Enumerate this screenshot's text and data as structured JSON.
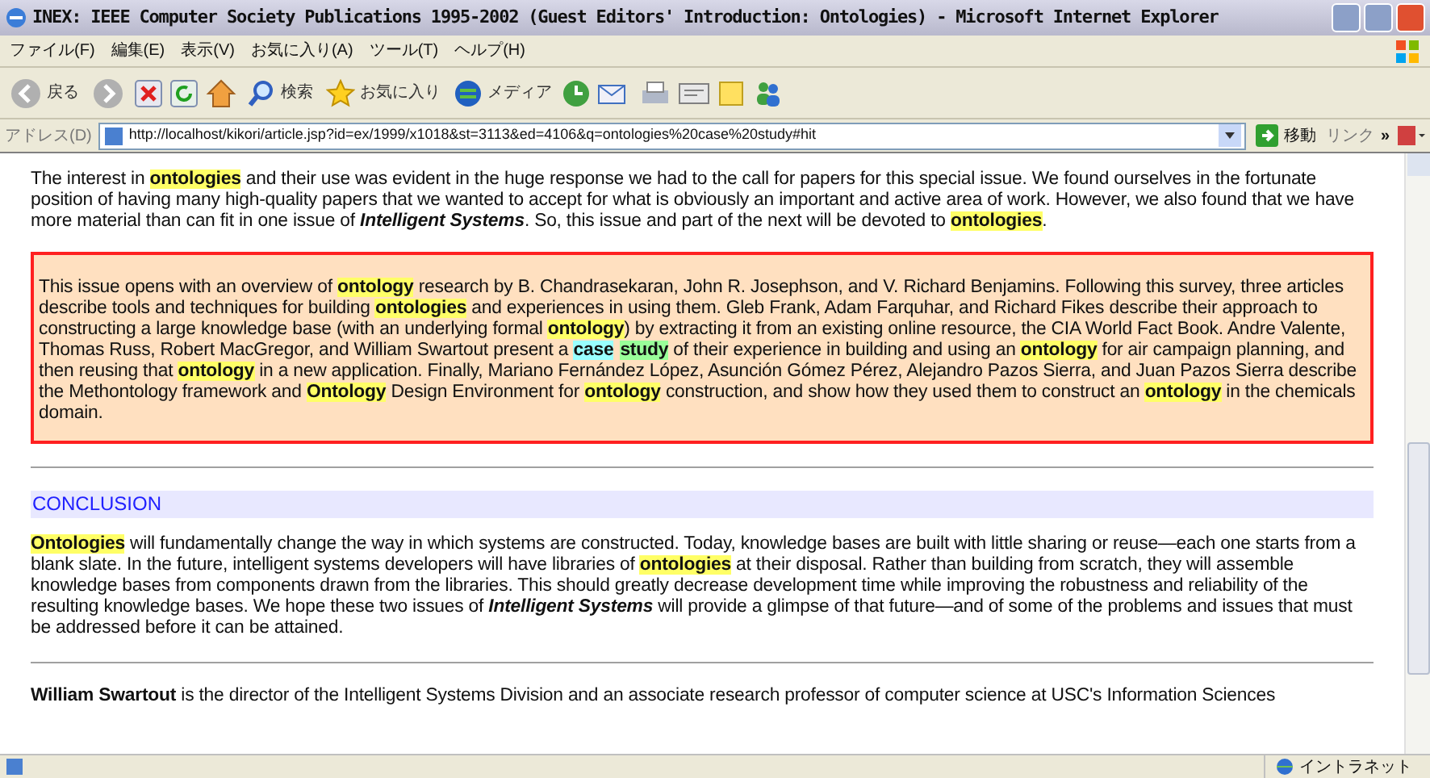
{
  "window": {
    "title": "INEX: IEEE Computer Society Publications 1995-2002 (Guest Editors' Introduction: Ontologies) - Microsoft Internet Explorer"
  },
  "menu": [
    "ファイル(F)",
    "編集(E)",
    "表示(V)",
    "お気に入り(A)",
    "ツール(T)",
    "ヘルプ(H)"
  ],
  "toolbar": {
    "back": "戻る",
    "search": "検索",
    "favorites": "お気に入り",
    "media": "メディア"
  },
  "address_bar": {
    "label": "アドレス(D)",
    "value": "http://localhost/kikori/article.jsp?id=ex/1999/x1018&st=3113&ed=4106&q=ontologies%20case%20study#hit",
    "go": "移動",
    "links": "リンク",
    "more": "»"
  },
  "content": [
    {
      "kind": "paragraph",
      "segments": [
        {
          "kind": "plain",
          "text": "The interest in "
        },
        {
          "kind": "hit",
          "color": "#ffff66",
          "text": "ontologies"
        },
        {
          "kind": "plain",
          "text": " and their use was evident in the huge response we had to the call for papers for this special issue. We found ourselves in the fortunate position of having many high-quality papers that we wanted to accept for what is obviously an important and active area of work. However, we also found that we have more material than can fit in one issue of "
        },
        {
          "kind": "italic",
          "text": "Intelligent Systems"
        },
        {
          "kind": "plain",
          "text": ". So, this issue and part of the next will be devoted to "
        },
        {
          "kind": "hit",
          "color": "#ffff66",
          "text": "ontologies"
        },
        {
          "kind": "plain",
          "text": "."
        }
      ]
    },
    {
      "kind": "hit_box",
      "segments": [
        {
          "kind": "plain",
          "text": "This issue opens with an overview of "
        },
        {
          "kind": "hit",
          "color": "#ffff66",
          "text": "ontology"
        },
        {
          "kind": "plain",
          "text": " research by B. Chandrasekaran, John R. Josephson, and V. Richard Benjamins. Following this survey, three articles describe tools and techniques for building "
        },
        {
          "kind": "hit",
          "color": "#ffff66",
          "text": "ontologies"
        },
        {
          "kind": "plain",
          "text": " and experiences in using them. Gleb Frank, Adam Farquhar, and Richard Fikes describe their approach to constructing a large knowledge base (with an underlying formal "
        },
        {
          "kind": "hit",
          "color": "#ffff66",
          "text": "ontology"
        },
        {
          "kind": "plain",
          "text": ") by extracting it from an existing online resource, the CIA World Fact Book. Andre Valente, Thomas Russ, Robert MacGregor, and William Swartout present a "
        },
        {
          "kind": "hit",
          "color": "#99ffff",
          "text": "case"
        },
        {
          "kind": "hit",
          "color": "#99ff99",
          "text": "study"
        },
        {
          "kind": "plain",
          "text": " of their experience in building and using an "
        },
        {
          "kind": "hit",
          "color": "#ffff66",
          "text": "ontology"
        },
        {
          "kind": "plain",
          "text": " for air campaign planning, and then reusing that "
        },
        {
          "kind": "hit",
          "color": "#ffff66",
          "text": "ontology"
        },
        {
          "kind": "plain",
          "text": " in a new application. Finally, Mariano Fernández López, Asunción Gómez Pérez, Alejandro Pazos Sierra, and Juan Pazos Sierra describe the Methontology framework and "
        },
        {
          "kind": "hit",
          "color": "#ffff66",
          "text": "Ontology"
        },
        {
          "kind": "plain",
          "text": " Design Environment for "
        },
        {
          "kind": "hit",
          "color": "#ffff66",
          "text": "ontology"
        },
        {
          "kind": "plain",
          "text": " construction, and show how they used them to construct an "
        },
        {
          "kind": "hit",
          "color": "#ffff66",
          "text": "ontology"
        },
        {
          "kind": "plain",
          "text": " in the chemicals domain."
        }
      ]
    },
    {
      "kind": "rule"
    },
    {
      "kind": "heading",
      "text": "CONCLUSION"
    },
    {
      "kind": "paragraph",
      "segments": [
        {
          "kind": "hit",
          "color": "#ffff66",
          "text": "Ontologies"
        },
        {
          "kind": "plain",
          "text": " will fundamentally change the way in which systems are constructed. Today, knowledge bases are built with little sharing or reuse—each one starts from a blank slate. In the future, intelligent systems developers will have libraries of "
        },
        {
          "kind": "hit",
          "color": "#ffff66",
          "text": "ontologies"
        },
        {
          "kind": "plain",
          "text": " at their disposal. Rather than building from scratch, they will assemble knowledge bases from components drawn from the libraries. This should greatly decrease development time while improving the robustness and reliability of the resulting knowledge bases. We hope these two issues of "
        },
        {
          "kind": "italic",
          "text": "Intelligent Systems"
        },
        {
          "kind": "plain",
          "text": " will provide a glimpse of that future—and of some of the problems and issues that must be addressed before it can be attained."
        }
      ]
    },
    {
      "kind": "rule"
    },
    {
      "kind": "paragraph",
      "segments": [
        {
          "kind": "bold",
          "text": "William Swartout"
        },
        {
          "kind": "plain",
          "text": " is the director of the Intelligent Systems Division and an associate research professor of computer science at USC's Information Sciences"
        }
      ]
    }
  ],
  "status_bar": {
    "zone": "イントラネット"
  }
}
